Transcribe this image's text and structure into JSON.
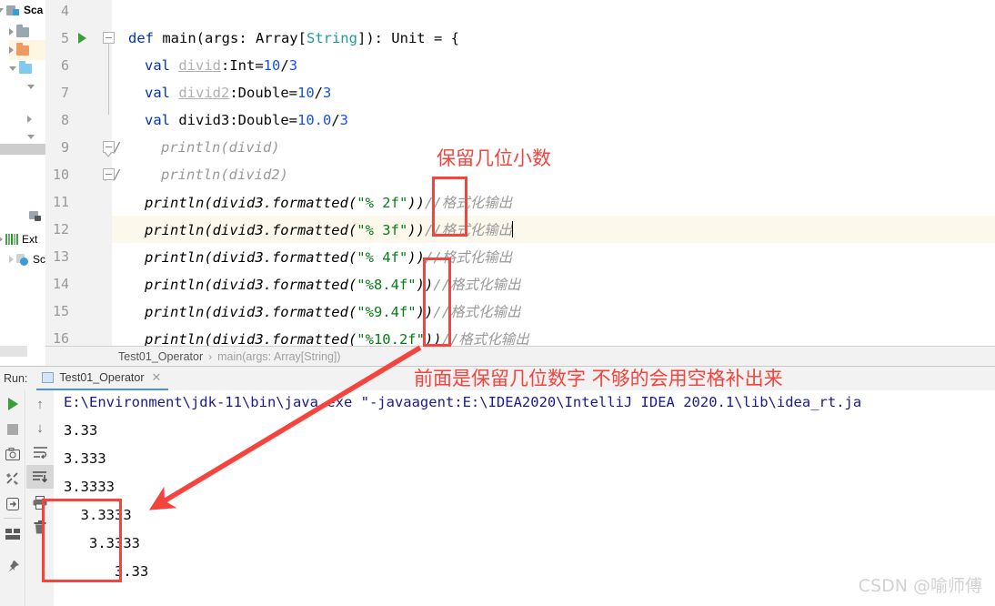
{
  "project_panel": {
    "items": [
      {
        "label": "Sca",
        "icon": "scala-module-icon",
        "kind": "module",
        "selected": false
      },
      {
        "label": "",
        "icon": "folder-grey-icon",
        "kind": "folder-grey",
        "selected": false
      },
      {
        "label": "",
        "icon": "folder-orange-icon",
        "kind": "folder-orange",
        "selected": true
      },
      {
        "label": "",
        "icon": "folder-blue-icon",
        "kind": "folder-blue",
        "selected": false
      },
      {
        "label": "",
        "icon": "chevron-down-icon",
        "kind": "chevron",
        "selected": false
      },
      {
        "label": "",
        "icon": "chevron-right-icon",
        "kind": "chevron",
        "selected": false
      },
      {
        "label": "",
        "icon": "chevron-down-icon",
        "kind": "chevron",
        "selected": false
      },
      {
        "label": "Ext",
        "icon": "external-libraries-icon",
        "kind": "extlib",
        "selected": false
      },
      {
        "label": "Scr",
        "icon": "scratches-icon",
        "kind": "scratch",
        "selected": false
      }
    ]
  },
  "editor": {
    "first_line_number": 4,
    "highlighted_line": 12,
    "lines": [
      {
        "n": 4,
        "gutter": "",
        "indent": 0,
        "tokens": []
      },
      {
        "n": 5,
        "gutter": "run",
        "fold": "minus-tail",
        "indent": 0,
        "tokens": [
          {
            "t": "def ",
            "c": "kw"
          },
          {
            "t": "main",
            "c": "plain"
          },
          {
            "t": "(args: Array[",
            "c": "plain"
          },
          {
            "t": "String",
            "c": "type-c"
          },
          {
            "t": "]): Unit = {",
            "c": "plain"
          }
        ]
      },
      {
        "n": 6,
        "gutter": "",
        "indent": 1,
        "tokens": [
          {
            "t": "val ",
            "c": "kw"
          },
          {
            "t": "divid",
            "c": "var-u"
          },
          {
            "t": ":Int=",
            "c": "plain"
          },
          {
            "t": "10",
            "c": "num"
          },
          {
            "t": "/",
            "c": "plain"
          },
          {
            "t": "3",
            "c": "num"
          }
        ]
      },
      {
        "n": 7,
        "gutter": "",
        "indent": 1,
        "tokens": [
          {
            "t": "val ",
            "c": "kw"
          },
          {
            "t": "divid2",
            "c": "var-u"
          },
          {
            "t": ":Double=",
            "c": "plain"
          },
          {
            "t": "10",
            "c": "num"
          },
          {
            "t": "/",
            "c": "plain"
          },
          {
            "t": "3",
            "c": "num"
          }
        ]
      },
      {
        "n": 8,
        "gutter": "",
        "indent": 1,
        "tokens": [
          {
            "t": "val ",
            "c": "kw"
          },
          {
            "t": "divid3",
            "c": "plain"
          },
          {
            "t": ":Double=",
            "c": "plain"
          },
          {
            "t": "10.0",
            "c": "num"
          },
          {
            "t": "/",
            "c": "plain"
          },
          {
            "t": "3",
            "c": "num"
          }
        ]
      },
      {
        "n": 9,
        "gutter": "",
        "fold": "pointer",
        "comment_prefix": "//",
        "indent": 2,
        "tokens": [
          {
            "t": "println(divid)",
            "c": "cmt"
          }
        ]
      },
      {
        "n": 10,
        "gutter": "",
        "fold": "minus",
        "comment_prefix": "//",
        "indent": 2,
        "tokens": [
          {
            "t": "println(divid2)",
            "c": "cmt"
          }
        ]
      },
      {
        "n": 11,
        "gutter": "",
        "indent": 1,
        "tokens": [
          {
            "t": "println(divid3.formatted(",
            "c": "ital"
          },
          {
            "t": "\"% 2f\"",
            "c": "str"
          },
          {
            "t": "))",
            "c": "ital"
          },
          {
            "t": "//格式化输出",
            "c": "cmt"
          }
        ]
      },
      {
        "n": 12,
        "gutter": "",
        "indent": 1,
        "caret": true,
        "tokens": [
          {
            "t": "println(divid3.formatted(",
            "c": "ital"
          },
          {
            "t": "\"% 3f\"",
            "c": "str"
          },
          {
            "t": "))",
            "c": "ital"
          },
          {
            "t": "//格式化输出",
            "c": "cmt"
          }
        ]
      },
      {
        "n": 13,
        "gutter": "",
        "indent": 1,
        "tokens": [
          {
            "t": "println(divid3.formatted(",
            "c": "ital"
          },
          {
            "t": "\"% 4f\"",
            "c": "str"
          },
          {
            "t": "))",
            "c": "ital"
          },
          {
            "t": "//格式化输出",
            "c": "cmt"
          }
        ]
      },
      {
        "n": 14,
        "gutter": "",
        "indent": 1,
        "tokens": [
          {
            "t": "println(divid3.formatted(",
            "c": "ital"
          },
          {
            "t": "\"%8.4f\"",
            "c": "str"
          },
          {
            "t": "))",
            "c": "ital"
          },
          {
            "t": "//格式化输出",
            "c": "cmt"
          }
        ]
      },
      {
        "n": 15,
        "gutter": "",
        "indent": 1,
        "tokens": [
          {
            "t": "println(divid3.formatted(",
            "c": "ital"
          },
          {
            "t": "\"%9.4f\"",
            "c": "str"
          },
          {
            "t": "))",
            "c": "ital"
          },
          {
            "t": "//格式化输出",
            "c": "cmt"
          }
        ]
      },
      {
        "n": 16,
        "gutter": "",
        "indent": 1,
        "tokens": [
          {
            "t": "println(divid3.formatted(",
            "c": "ital"
          },
          {
            "t": "\"%10.2f\"",
            "c": "str"
          },
          {
            "t": "))",
            "c": "ital"
          },
          {
            "t": "//格式化输出",
            "c": "cmt"
          }
        ]
      }
    ]
  },
  "breadcrumb": {
    "class_name": "Test01_Operator",
    "separator": "›",
    "method_name": "main(args: Array[String])"
  },
  "run_panel": {
    "label": "Run:",
    "tab_title": "Test01_Operator",
    "close_label": "✕",
    "toolbar_left": [
      {
        "name": "rerun-button",
        "glyph": "play"
      },
      {
        "name": "stop-button",
        "glyph": "stop"
      },
      {
        "name": "screenshot-button",
        "glyph": "⌾"
      },
      {
        "name": "restore-layout-button",
        "glyph": "⚒"
      },
      {
        "name": "export-button",
        "glyph": "⇥"
      },
      {
        "name": "layout-button",
        "glyph": "▤"
      },
      {
        "name": "pin-button",
        "glyph": "📌"
      }
    ],
    "toolbar_mid": [
      {
        "name": "scroll-up-button",
        "glyph": "↑"
      },
      {
        "name": "scroll-down-button",
        "glyph": "↓"
      },
      {
        "name": "soft-wrap-button",
        "glyph": "⇥"
      },
      {
        "name": "scroll-to-end-button",
        "glyph": "⇟",
        "active": true
      },
      {
        "name": "print-button",
        "glyph": "🖶"
      },
      {
        "name": "clear-all-button",
        "glyph": "🗑"
      }
    ],
    "console_lines": [
      {
        "text": "E:\\Environment\\jdk-11\\bin\\java.exe \"-javaagent:E:\\IDEA2020\\IntelliJ IDEA 2020.1\\lib\\idea_rt.ja",
        "kind": "cmd"
      },
      {
        "text": "3.33",
        "kind": "out"
      },
      {
        "text": "3.333",
        "kind": "out"
      },
      {
        "text": "3.3333",
        "kind": "out"
      },
      {
        "text": "  3.3333",
        "kind": "out"
      },
      {
        "text": "   3.3333",
        "kind": "out"
      },
      {
        "text": "      3.33",
        "kind": "out"
      }
    ]
  },
  "annotations": {
    "note_top": "保留几位小数",
    "note_bottom": "前面是保留几位数字 不够的会用空格补出来",
    "accent_color": "#f5433d"
  },
  "watermark": "CSDN @喻师傅"
}
